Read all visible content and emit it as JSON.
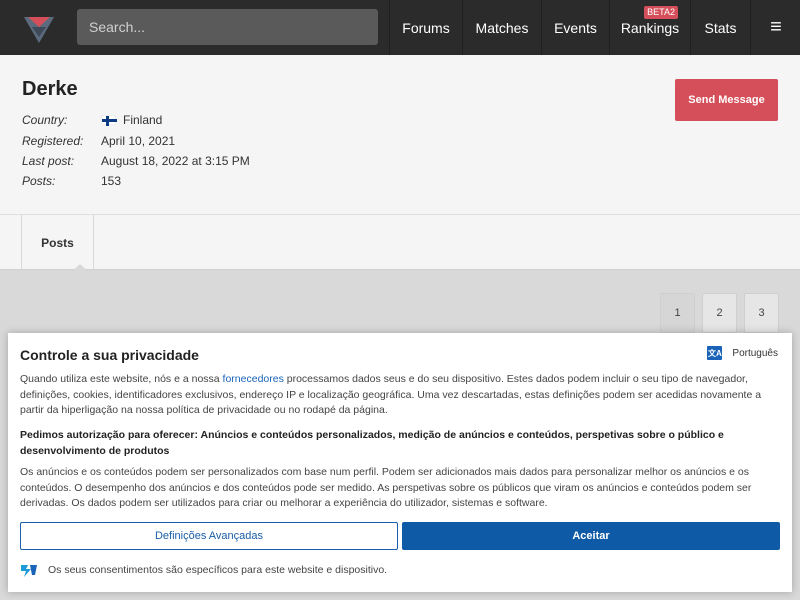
{
  "navbar": {
    "search_placeholder": "Search...",
    "items": [
      {
        "label": "Forums"
      },
      {
        "label": "Matches"
      },
      {
        "label": "Events"
      },
      {
        "label": "Rankings",
        "badge": "BETA2"
      },
      {
        "label": "Stats"
      }
    ],
    "menu_icon": "≡"
  },
  "profile": {
    "name": "Derke",
    "country_label": "Country:",
    "country_value": "Finland",
    "registered_label": "Registered:",
    "registered_value": "April 10, 2021",
    "last_post_label": "Last post:",
    "last_post_value": "August 18, 2022 at 3:15 PM",
    "posts_label": "Posts:",
    "posts_value": "153",
    "send_button": "Send Message"
  },
  "tabs": [
    {
      "label": "Posts"
    }
  ],
  "pagination": [
    "1",
    "2",
    "3"
  ],
  "consent": {
    "title": "Controle a sua privacidade",
    "language": "Português",
    "intro_before": "Quando utiliza este website, nós e a nossa ",
    "intro_link": "fornecedores",
    "intro_after": " processamos dados seus e do seu dispositivo. Estes dados podem incluir o seu tipo de navegador, definições, cookies, identificadores exclusivos, endereço IP e localização geográfica. Uma vez descartadas, estas definições podem ser acedidas novamente a partir da hiperligação na nossa política de privacidade ou no rodapé da página.",
    "purposes": "Pedimos autorização para oferecer: Anúncios e conteúdos personalizados, medição de anúncios e conteúdos, perspetivas sobre o público e desenvolvimento de produtos",
    "details": "Os anúncios e os conteúdos podem ser personalizados com base num perfil. Podem ser adicionados mais dados para personalizar melhor os anúncios e os conteúdos. O desempenho dos anúncios e dos conteúdos pode ser medido. As perspetivas sobre os públicos que viram os anúncios e conteúdos podem ser derivadas. Os dados podem ser utilizados para criar ou melhorar a experiência do utilizador, sistemas e software.",
    "advanced_button": "Definições Avançadas",
    "accept_button": "Aceitar",
    "footer": "Os seus consentimentos são específicos para este website e dispositivo."
  },
  "colors": {
    "navbar_bg": "#2b2b2b",
    "accent_red": "#d54f5a",
    "consent_blue": "#0e5aa7"
  },
  "icons": {
    "logo": "site-logo-icon",
    "menu": "hamburger-menu-icon",
    "flag": "finland-flag-icon",
    "language": "translate-icon",
    "footer": "consent-provider-icon"
  }
}
